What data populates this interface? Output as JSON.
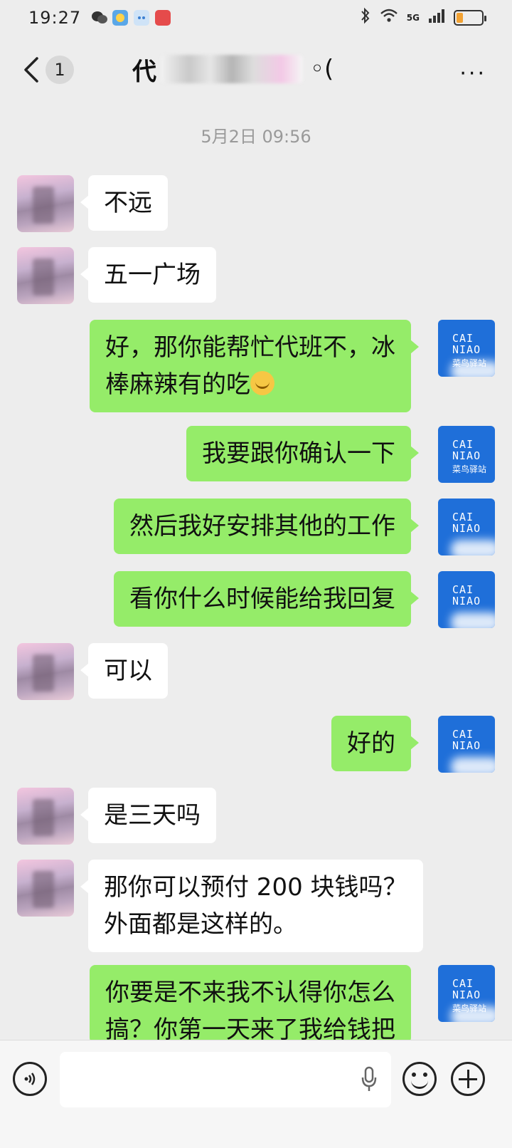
{
  "status_bar": {
    "time": "19:27",
    "network": "5G",
    "battery_level": 0.25,
    "icons": [
      "wechat-icon",
      "weather-icon",
      "assistant-icon",
      "app-icon",
      "bluetooth-icon",
      "wifi-icon",
      "signal-icon",
      "battery-icon"
    ]
  },
  "header": {
    "unread_count": "1",
    "title_prefix": "代",
    "title_suffix": "◦(",
    "more_label": "···"
  },
  "timestamp": "5月2日 09:56",
  "contact_avatar_brand": {
    "line1": "CAI",
    "line2": "NIAO",
    "line3": "菜鸟驿站"
  },
  "messages": [
    {
      "side": "left",
      "text": "不远"
    },
    {
      "side": "left",
      "text": "五一广场"
    },
    {
      "side": "right",
      "line1": "好，那你能帮忙代班不，冰",
      "line2": "棒麻辣有的吃",
      "emoji": "crying-laughing-emoji"
    },
    {
      "side": "right",
      "text": "我要跟你确认一下"
    },
    {
      "side": "right",
      "text": "然后我好安排其他的工作"
    },
    {
      "side": "right",
      "text": "看你什么时候能给我回复"
    },
    {
      "side": "left",
      "text": "可以"
    },
    {
      "side": "right",
      "text": "好的"
    },
    {
      "side": "left",
      "text": "是三天吗"
    },
    {
      "side": "left",
      "line1": "那你可以预付 200 块钱吗？",
      "line2": "外面都是这样的。"
    },
    {
      "side": "right",
      "line1": "你要是不来我不认得你怎么",
      "line2": "搞？你第一天来了我给钱把"
    }
  ],
  "colors": {
    "background": "#ededed",
    "sent_bubble": "#95ec69",
    "received_bubble": "#ffffff",
    "avatar_blue": "#1f6fd9"
  }
}
